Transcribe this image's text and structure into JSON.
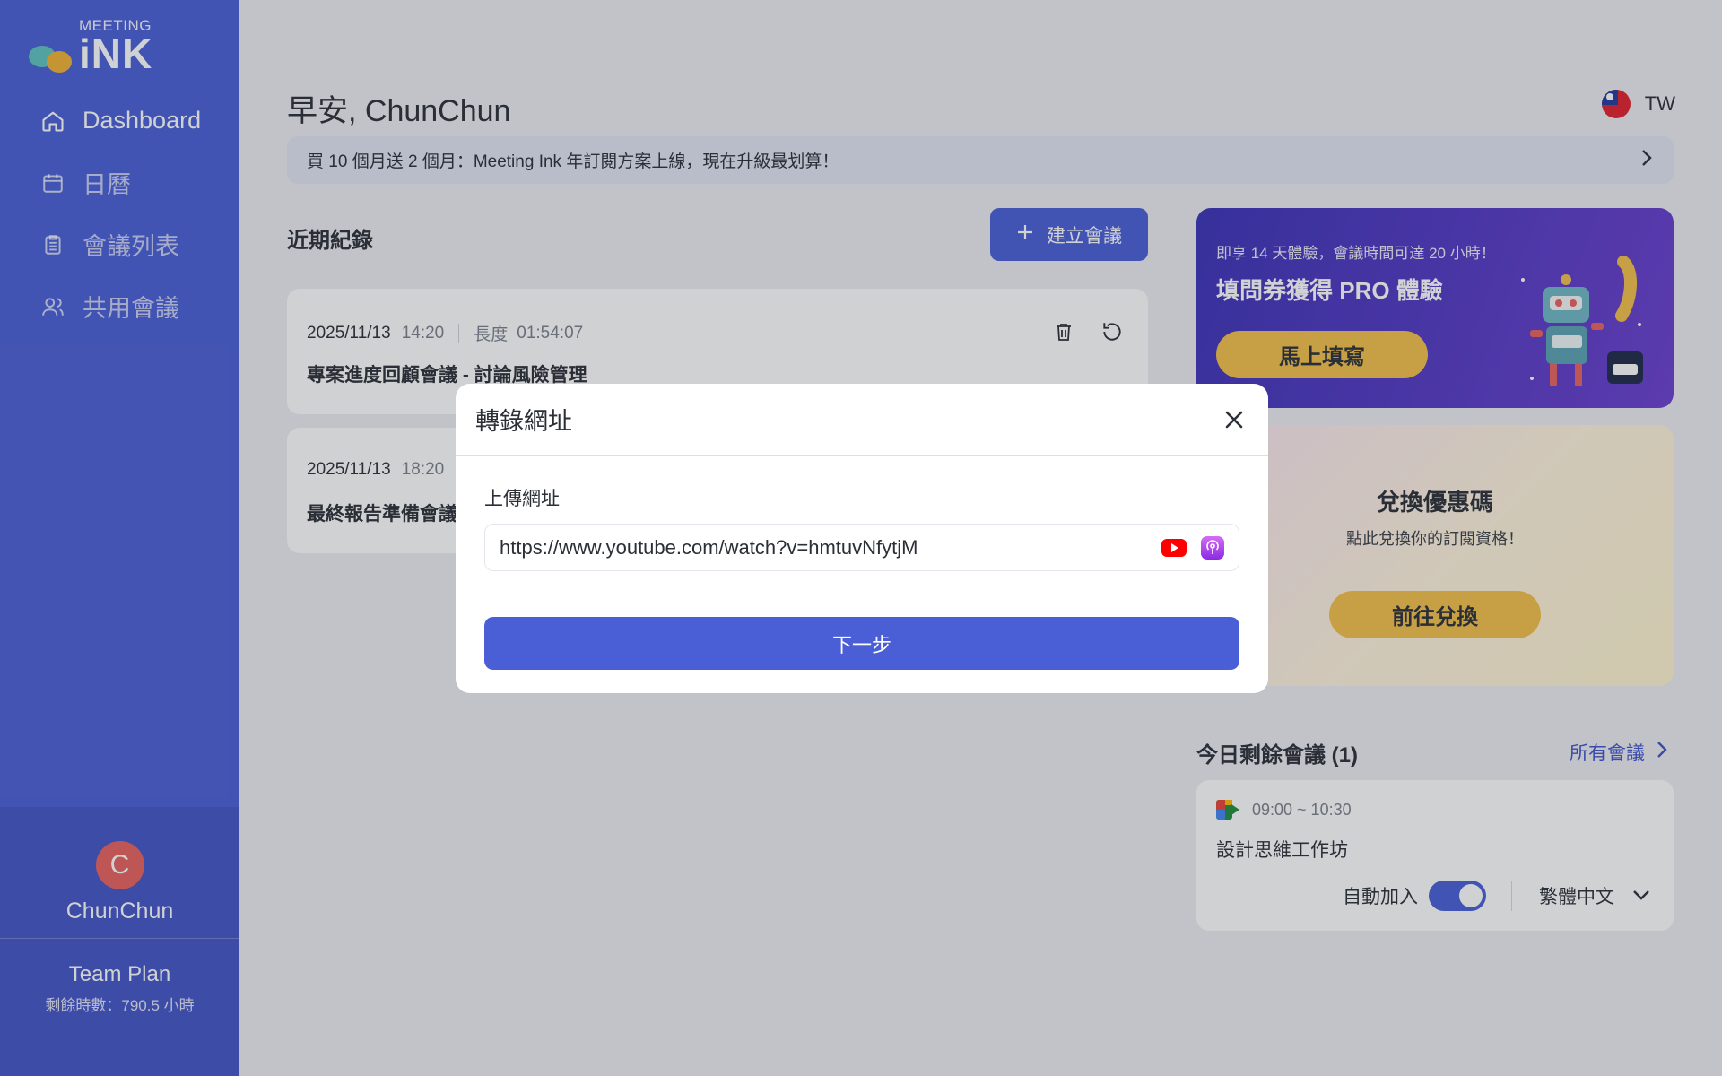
{
  "app": {
    "logo_small": "MEETING",
    "logo_big": "iNK"
  },
  "sidebar": {
    "items": [
      {
        "label": "Dashboard",
        "icon": "home-icon",
        "active": true
      },
      {
        "label": "日曆",
        "icon": "calendar-icon"
      },
      {
        "label": "會議列表",
        "icon": "clipboard-icon"
      },
      {
        "label": "共用會議",
        "icon": "users-icon"
      }
    ],
    "user": {
      "initial": "C",
      "name": "ChunChun"
    },
    "plan": {
      "name": "Team Plan",
      "hours": "剩餘時數：790.5 小時"
    }
  },
  "header": {
    "greeting": "早安, ChunChun",
    "locale": "TW",
    "banner": "買 10 個月送 2 個月：Meeting Ink 年訂閱方案上線，現在升級最划算！"
  },
  "records": {
    "title": "近期紀錄",
    "create_label": "建立會議",
    "items": [
      {
        "date": "2025/11/13",
        "time": "14:20",
        "length_label": "長度",
        "length": "01:54:07",
        "title": "專案進度回顧會議 - 討論風險管理"
      },
      {
        "date": "2025/11/13",
        "time": "18:20",
        "title": "最終報告準備會議"
      }
    ]
  },
  "promo": {
    "sub": "即享 14 天體驗，會議時間可達 20 小時！",
    "head": "填問券獲得 PRO 體驗",
    "cta": "馬上填寫"
  },
  "redeem": {
    "head": "兌換優惠碼",
    "sub": "點此兌換你的訂閱資格！",
    "cta": "前往兌換"
  },
  "today": {
    "title": "今日剩餘會議 (1)",
    "all_link": "所有會議",
    "meeting": {
      "time": "09:00 ~ 10:30",
      "title": "設計思維工作坊",
      "auto_join": "自動加入",
      "auto_join_on": true,
      "language": "繁體中文"
    }
  },
  "modal": {
    "title": "轉錄網址",
    "field_label": "上傳網址",
    "url_value": "https://www.youtube.com/watch?v=hmtuvNfytjM",
    "next_label": "下一步"
  },
  "colors": {
    "primary": "#4a5fd6",
    "accent_yellow": "#f4c04a",
    "avatar": "#e8625f"
  }
}
